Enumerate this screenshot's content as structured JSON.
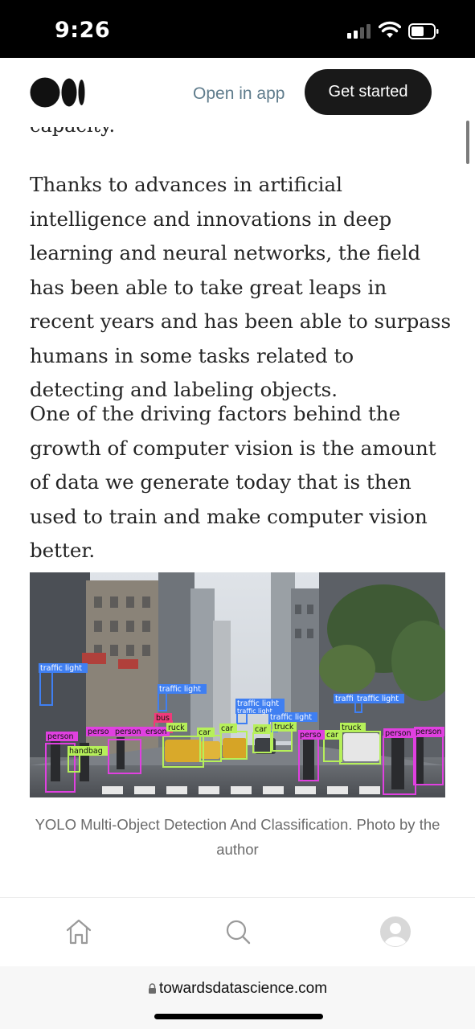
{
  "status_bar": {
    "time": "9:26"
  },
  "header": {
    "open_in_app": "Open in app",
    "get_started": "Get started"
  },
  "article": {
    "cut_line": "capacity.",
    "paragraphs": [
      "Thanks to advances in artificial intelligence and innovations in deep learning and neural networks, the field has been able to take great leaps in recent years and has been able to surpass humans in some tasks related to detecting and labeling objects.",
      "One of the driving factors behind the growth of computer vision is the amount of data we generate today that is then used to train and make computer vision better."
    ],
    "figure": {
      "labels": {
        "traffic_light_1": "traffic light",
        "traffic_light_2": "traffic light",
        "traffic_light_3": "traffic light",
        "traffic_light_4": "traffic light",
        "traffic_light_5": "traffic light",
        "traffic_light_6": "traffi",
        "traffic_light_7": "traffic light",
        "bus": "bus",
        "person_1": "person",
        "person_2": "perso",
        "person_3": "person",
        "person_4": "erson",
        "person_5": "perso",
        "person_6": "person",
        "person_7": "person",
        "handbag": "handbag",
        "truck_1": "ruck",
        "truck_2": "truck",
        "truck_3": "truck",
        "car_1": "car",
        "car_2": "car",
        "car_3": "car",
        "car_4": "car"
      },
      "caption": "YOLO Multi-Object Detection And Classification. Photo by the author"
    }
  },
  "bottom_nav": {
    "icons": [
      "home-icon",
      "search-icon",
      "profile-icon"
    ]
  },
  "address_bar": {
    "url": "towardsdatascience.com"
  },
  "colors": {
    "label_person": "#e040e0",
    "label_vehicle": "#b6f05a",
    "label_traffic": "#3f7ff2",
    "label_bus": "#ef3a7a"
  }
}
